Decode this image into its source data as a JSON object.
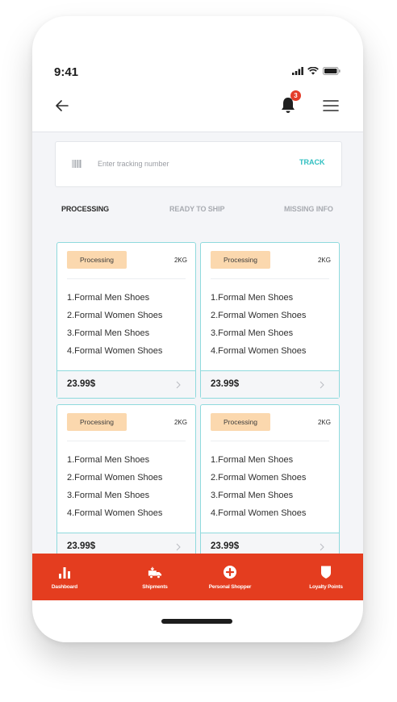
{
  "status_bar": {
    "time": "9:41"
  },
  "header": {
    "notification_count": "3"
  },
  "search": {
    "placeholder": "Enter tracking number",
    "value": "",
    "track_label": "TRACK"
  },
  "tabs": [
    {
      "label": "PROCESSING",
      "active": true
    },
    {
      "label": "READY TO SHIP",
      "active": false
    },
    {
      "label": "MISSING INFO",
      "active": false
    }
  ],
  "cards": [
    {
      "status": "Processing",
      "weight": "2KG",
      "items": [
        "1.Formal Men Shoes",
        "2.Formal Women Shoes",
        "3.Formal Men Shoes",
        "4.Formal Women Shoes"
      ],
      "price": "23.99$"
    },
    {
      "status": "Processing",
      "weight": "2KG",
      "items": [
        "1.Formal Men Shoes",
        "2.Formal Women Shoes",
        "3.Formal Men Shoes",
        "4.Formal Women Shoes"
      ],
      "price": "23.99$"
    },
    {
      "status": "Processing",
      "weight": "2KG",
      "items": [
        "1.Formal Men Shoes",
        "2.Formal Women Shoes",
        "3.Formal Men Shoes",
        "4.Formal Women Shoes"
      ],
      "price": "23.99$"
    },
    {
      "status": "Processing",
      "weight": "2KG",
      "items": [
        "1.Formal Men Shoes",
        "2.Formal Women Shoes",
        "3.Formal Men Shoes",
        "4.Formal Women Shoes"
      ],
      "price": "23.99$"
    }
  ],
  "bottom_nav": [
    {
      "label": "Dashboard",
      "icon": "bar-chart-icon"
    },
    {
      "label": "Shipments",
      "icon": "truck-icon"
    },
    {
      "label": "Personal Shopper",
      "icon": "plus-circle-icon"
    },
    {
      "label": "Loyalty Points",
      "icon": "shield-icon"
    }
  ],
  "colors": {
    "accent": "#2fbfc1",
    "brand_red": "#e43d1f",
    "badge_bg": "#fbd8ae",
    "card_border": "#8fdadd"
  }
}
